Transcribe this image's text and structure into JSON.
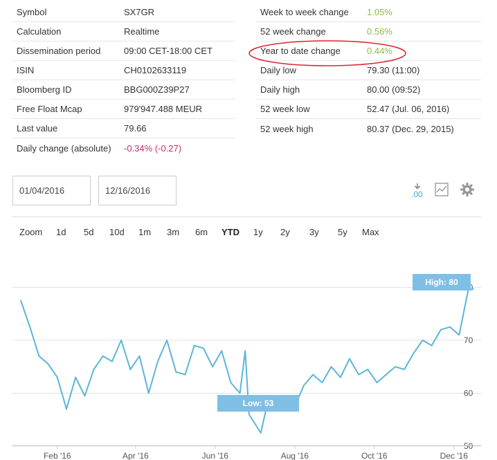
{
  "left_info": [
    {
      "key": "Symbol",
      "value": "SX7GR"
    },
    {
      "key": "Calculation",
      "value": "Realtime"
    },
    {
      "key": "Dissemination period",
      "value": "09:00 CET-18:00 CET"
    },
    {
      "key": "ISIN",
      "value": "CH0102633119"
    },
    {
      "key": "Bloomberg ID",
      "value": "BBG000Z39P27"
    },
    {
      "key": "Free Float Mcap",
      "value": "979'947.488 MEUR"
    },
    {
      "key": "Last value",
      "value": "79.66"
    },
    {
      "key": "Daily change (absolute)",
      "value": "-0.34% (-0.27)"
    }
  ],
  "right_info": [
    {
      "key": "Week to week change",
      "value": "1.05%"
    },
    {
      "key": "52 week change",
      "value": "0.56%"
    },
    {
      "key": "Year to date change",
      "value": "0.44%"
    },
    {
      "key": "Daily low",
      "value": "79.30 (11:00)"
    },
    {
      "key": "Daily high",
      "value": "80.00 (09:52)"
    },
    {
      "key": "52 week low",
      "value": "52.47 (Jul. 06, 2016)"
    },
    {
      "key": "52 week high",
      "value": "80.37 (Dec. 29, 2015)"
    }
  ],
  "date_range": {
    "from": "01/04/2016",
    "to": "12/16/2016"
  },
  "toolbar": {
    "download_label": ".00"
  },
  "zoom": {
    "label": "Zoom",
    "options": [
      "1d",
      "5d",
      "10d",
      "1m",
      "3m",
      "6m",
      "YTD",
      "1y",
      "2y",
      "3y",
      "5y",
      "Max"
    ],
    "active": "YTD"
  },
  "colors": {
    "line": "#5bb5d6",
    "flag": "#7fbfe6",
    "positive": "#8fb84a",
    "negative": "#c0306a",
    "highlight_circle": "#d9262d"
  },
  "chart_data": {
    "type": "line",
    "x": [
      "2016-01-04",
      "2016-01-11",
      "2016-01-18",
      "2016-01-25",
      "2016-02-01",
      "2016-02-08",
      "2016-02-15",
      "2016-02-22",
      "2016-02-29",
      "2016-03-07",
      "2016-03-14",
      "2016-03-21",
      "2016-03-28",
      "2016-04-04",
      "2016-04-11",
      "2016-04-18",
      "2016-04-25",
      "2016-05-02",
      "2016-05-09",
      "2016-05-16",
      "2016-05-23",
      "2016-05-30",
      "2016-06-06",
      "2016-06-13",
      "2016-06-20",
      "2016-06-24",
      "2016-06-27",
      "2016-07-06",
      "2016-07-11",
      "2016-07-18",
      "2016-07-25",
      "2016-08-01",
      "2016-08-08",
      "2016-08-15",
      "2016-08-22",
      "2016-08-29",
      "2016-09-05",
      "2016-09-12",
      "2016-09-19",
      "2016-09-26",
      "2016-10-03",
      "2016-10-10",
      "2016-10-17",
      "2016-10-24",
      "2016-10-31",
      "2016-11-07",
      "2016-11-14",
      "2016-11-21",
      "2016-11-28",
      "2016-12-05",
      "2016-12-12",
      "2016-12-16"
    ],
    "y": [
      77.5,
      72.5,
      67.0,
      65.5,
      63.0,
      57.0,
      63.0,
      59.5,
      64.5,
      67.0,
      66.0,
      70.0,
      64.5,
      67.0,
      60.0,
      66.0,
      70.0,
      64.0,
      63.5,
      69.0,
      68.5,
      65.0,
      68.0,
      62.0,
      60.0,
      68.0,
      56.0,
      52.5,
      58.0,
      59.5,
      58.5,
      57.5,
      61.5,
      63.5,
      62.0,
      65.0,
      63.0,
      66.5,
      63.5,
      64.5,
      62.0,
      63.5,
      65.0,
      64.5,
      67.5,
      70.0,
      69.0,
      72.0,
      72.5,
      71.0,
      79.5,
      79.66
    ],
    "ylim": [
      50,
      82
    ],
    "y_ticks": [
      50,
      60,
      70,
      80
    ],
    "x_ticks": [
      "Feb '16",
      "Apr '16",
      "Jun '16",
      "Aug '16",
      "Oct '16",
      "Dec '16"
    ],
    "x_tick_dates": [
      "2016-02-01",
      "2016-04-01",
      "2016-06-01",
      "2016-08-01",
      "2016-10-01",
      "2016-12-01"
    ],
    "x_range": [
      "2016-01-04",
      "2016-12-16"
    ],
    "grid": true,
    "flags": [
      {
        "label": "High: 80",
        "value": 80,
        "date": "2016-12-16"
      },
      {
        "label": "Low: 53",
        "value": 52.5,
        "date": "2016-07-06"
      }
    ]
  }
}
